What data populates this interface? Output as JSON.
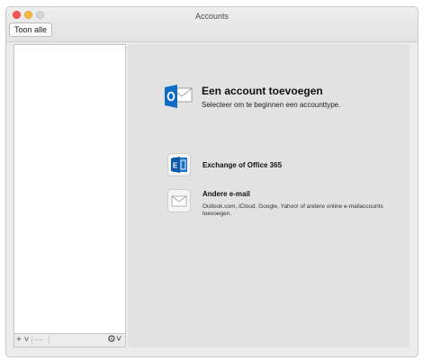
{
  "window": {
    "title": "Accounts"
  },
  "toolbar": {
    "show_all_label": "Toon alle"
  },
  "sidebar": {
    "add_label": "+ ˅",
    "remove_label": "—",
    "gear_label": "⚙˅"
  },
  "main": {
    "hero": {
      "title": "Een account toevoegen",
      "subtitle": "Selecteer om te beginnen een accounttype."
    },
    "options": [
      {
        "label": "Exchange of Office 365",
        "icon": "exchange-icon"
      },
      {
        "label": "Andere e-mail",
        "description": "Outlook.com, iCloud, Google, Yahoo! of andere online e-mailaccounts toevoegen.",
        "icon": "envelope-icon"
      }
    ]
  },
  "colors": {
    "outlook_blue": "#0f6cc4",
    "exchange_blue": "#1f71c7",
    "close": "#fc5753",
    "minimize": "#fdbc40"
  }
}
